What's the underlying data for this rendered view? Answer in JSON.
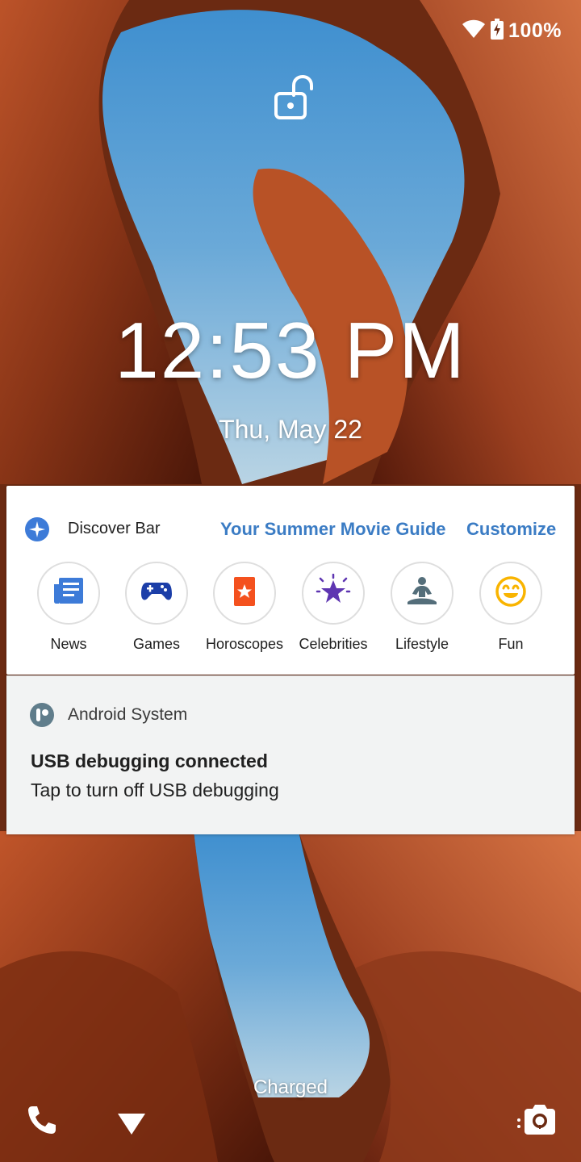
{
  "status_bar": {
    "battery_percent": "100%",
    "icons": [
      "wifi-icon",
      "battery-charging-icon"
    ]
  },
  "lock_screen": {
    "lock_icon": "unlocked-padlock-icon",
    "time": "12:53 PM",
    "date": "Thu, May 22",
    "charging_status": "Charged"
  },
  "discover_bar": {
    "title": "Discover Bar",
    "featured_link": "Your Summer Movie Guide",
    "customize_label": "Customize",
    "accent_color": "#3b7cc4",
    "categories": [
      {
        "label": "News",
        "icon": "newspaper-icon",
        "color": "#3d7bd8"
      },
      {
        "label": "Games",
        "icon": "gamepad-icon",
        "color": "#1b3ea8"
      },
      {
        "label": "Horoscopes",
        "icon": "star-card-icon",
        "color": "#f4511e"
      },
      {
        "label": "Celebrities",
        "icon": "star-burst-icon",
        "color": "#5e35b1"
      },
      {
        "label": "Lifestyle",
        "icon": "yoga-icon",
        "color": "#546e7a"
      },
      {
        "label": "Fun",
        "icon": "smiley-icon",
        "color": "#f9b400"
      }
    ]
  },
  "notification": {
    "app_name": "Android System",
    "title": "USB debugging connected",
    "text": "Tap to turn off USB debugging"
  },
  "bottom_bar": {
    "left_shortcut": "phone-icon",
    "center_icon": "chevron-down-icon",
    "right_shortcut": "camera-icon"
  }
}
